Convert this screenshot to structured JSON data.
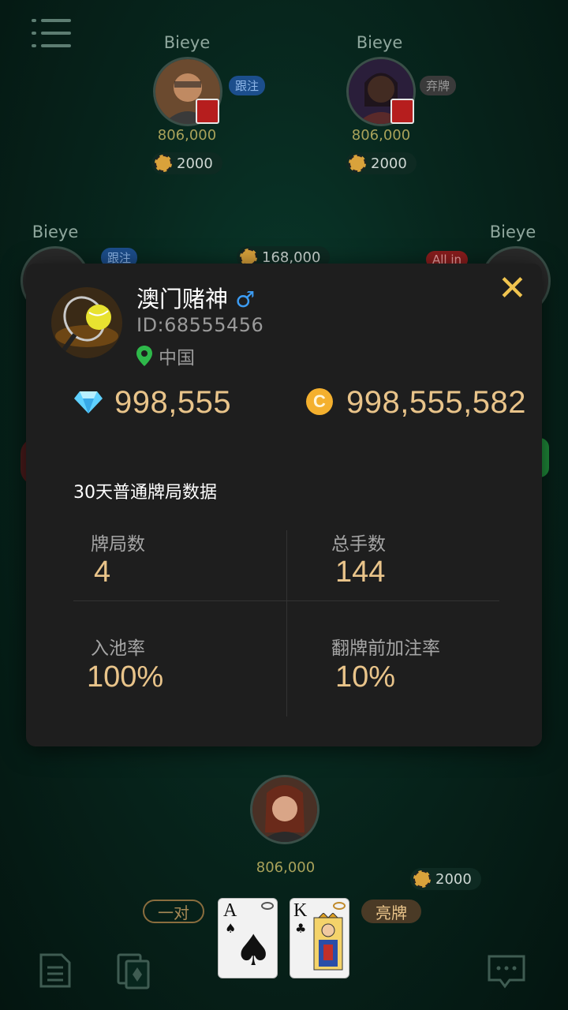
{
  "players": [
    {
      "name": "Bieye",
      "chips": "806,000",
      "bet": "2000",
      "status": "跟注"
    },
    {
      "name": "Bieye",
      "chips": "806,000",
      "bet": "2000",
      "status": "弃牌"
    },
    {
      "name": "Bieye",
      "status": "跟注"
    },
    {
      "name": "Bieye",
      "status": "All in"
    }
  ],
  "pot": "168,000",
  "self": {
    "chips": "806,000",
    "bet": "2000",
    "hand_label": "一对",
    "show_button": "亮牌",
    "cards": [
      {
        "rank": "A",
        "suit": "♠"
      },
      {
        "rank": "K",
        "suit": "♣"
      }
    ]
  },
  "modal": {
    "nickname": "澳门赌神",
    "gender_symbol": "♂",
    "id_text": "ID:68555456",
    "location": "中国",
    "diamonds": "998,555",
    "coins": "998,555,582",
    "coin_symbol": "C",
    "section_title": "30天普通牌局数据",
    "stats": [
      {
        "label": "牌局数",
        "value": "4"
      },
      {
        "label": "总手数",
        "value": "144"
      },
      {
        "label": "入池率",
        "value": "100%"
      },
      {
        "label": "翻牌前加注率",
        "value": "10%"
      }
    ],
    "close_symbol": "✕"
  }
}
